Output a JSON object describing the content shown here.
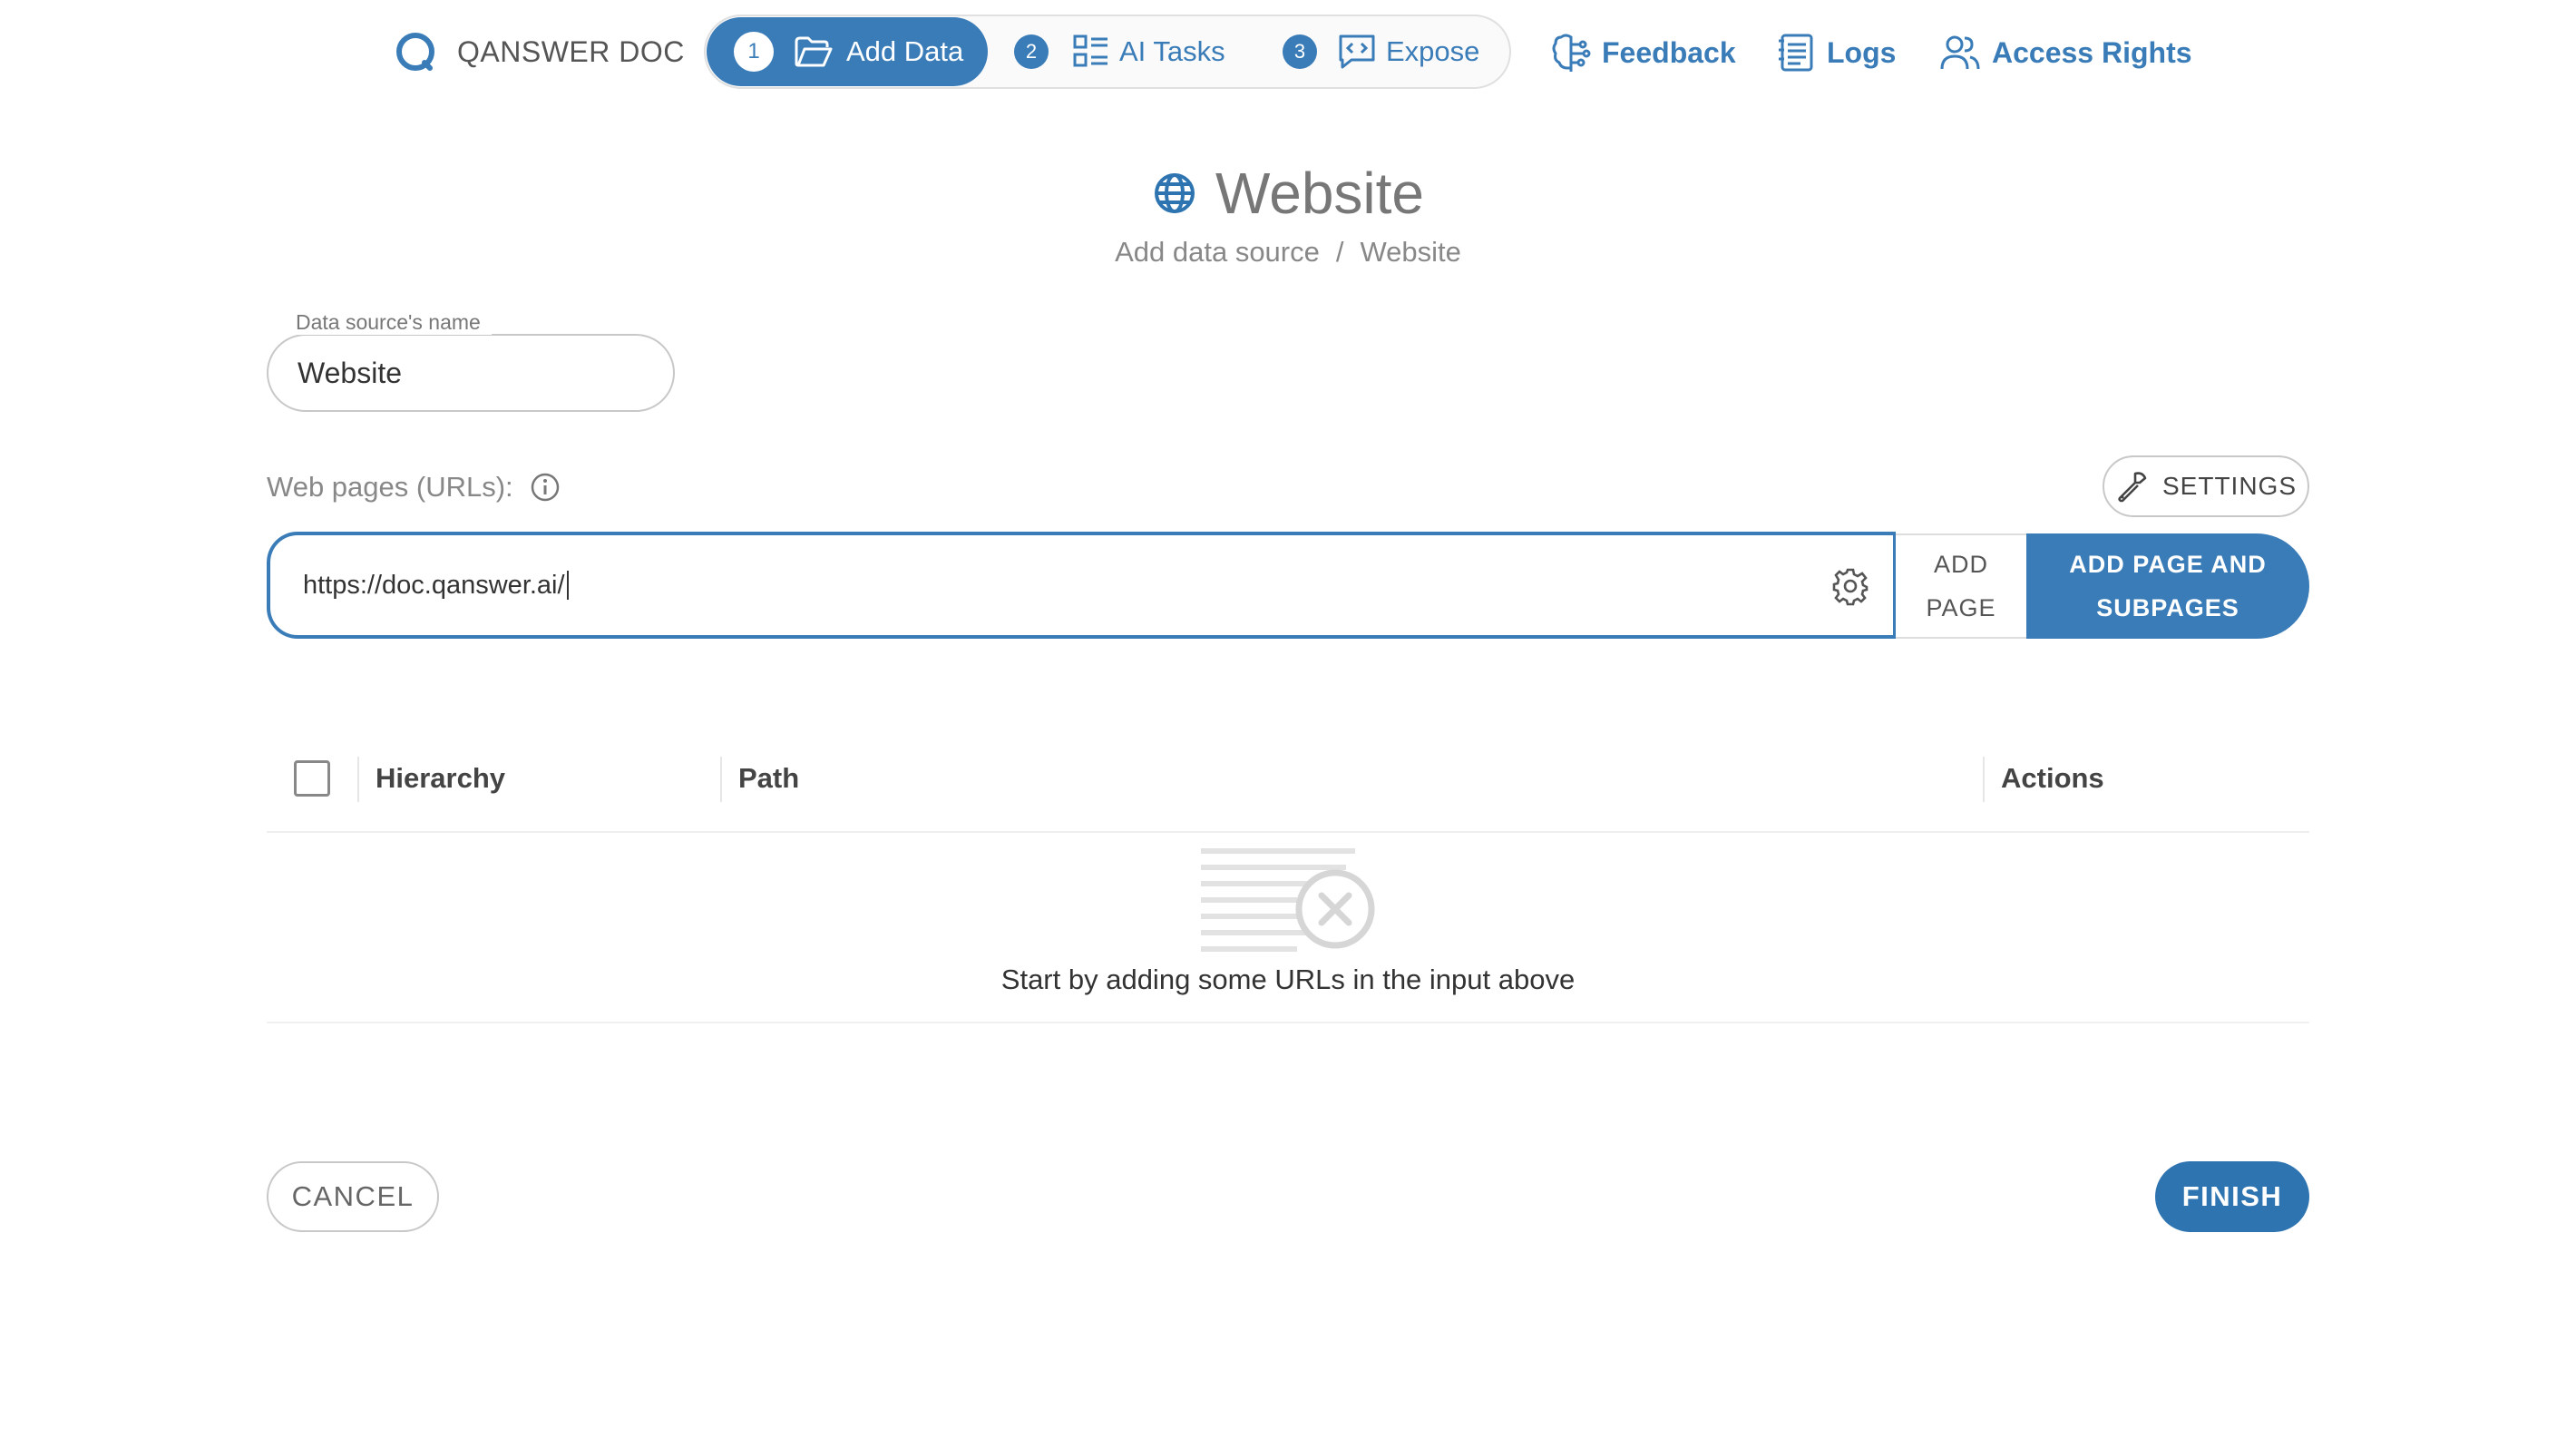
{
  "colors": {
    "accent": "#3a7cb8",
    "finish": "#2e74b0"
  },
  "header": {
    "brand": "QANSWER DOC",
    "steps": [
      {
        "num": "1",
        "label": "Add Data",
        "icon": "folder-open-icon",
        "active": true
      },
      {
        "num": "2",
        "label": "AI Tasks",
        "icon": "list-grid-icon",
        "active": false
      },
      {
        "num": "3",
        "label": "Expose",
        "icon": "code-chat-icon",
        "active": false
      }
    ],
    "links": [
      {
        "label": "Feedback",
        "icon": "brain-icon"
      },
      {
        "label": "Logs",
        "icon": "log-list-icon"
      },
      {
        "label": "Access Rights",
        "icon": "users-icon"
      }
    ]
  },
  "page": {
    "title": "Website",
    "title_icon": "globe-icon",
    "breadcrumb": [
      "Add data source",
      "/",
      "Website"
    ]
  },
  "form": {
    "ds_name_label": "Data source's name",
    "ds_name_value": "Website",
    "urls_label": "Web pages (URLs):",
    "settings_label": "SETTINGS",
    "url_value": "https://doc.qanswer.ai/",
    "add_page_line1": "ADD",
    "add_page_line2": "PAGE",
    "add_sub_line1": "ADD PAGE AND",
    "add_sub_line2": "SUBPAGES"
  },
  "table": {
    "columns": [
      "Hierarchy",
      "Path",
      "Actions"
    ],
    "rows": [],
    "empty_message": "Start by adding some URLs in the input above"
  },
  "footer": {
    "cancel": "CANCEL",
    "finish": "FINISH"
  }
}
